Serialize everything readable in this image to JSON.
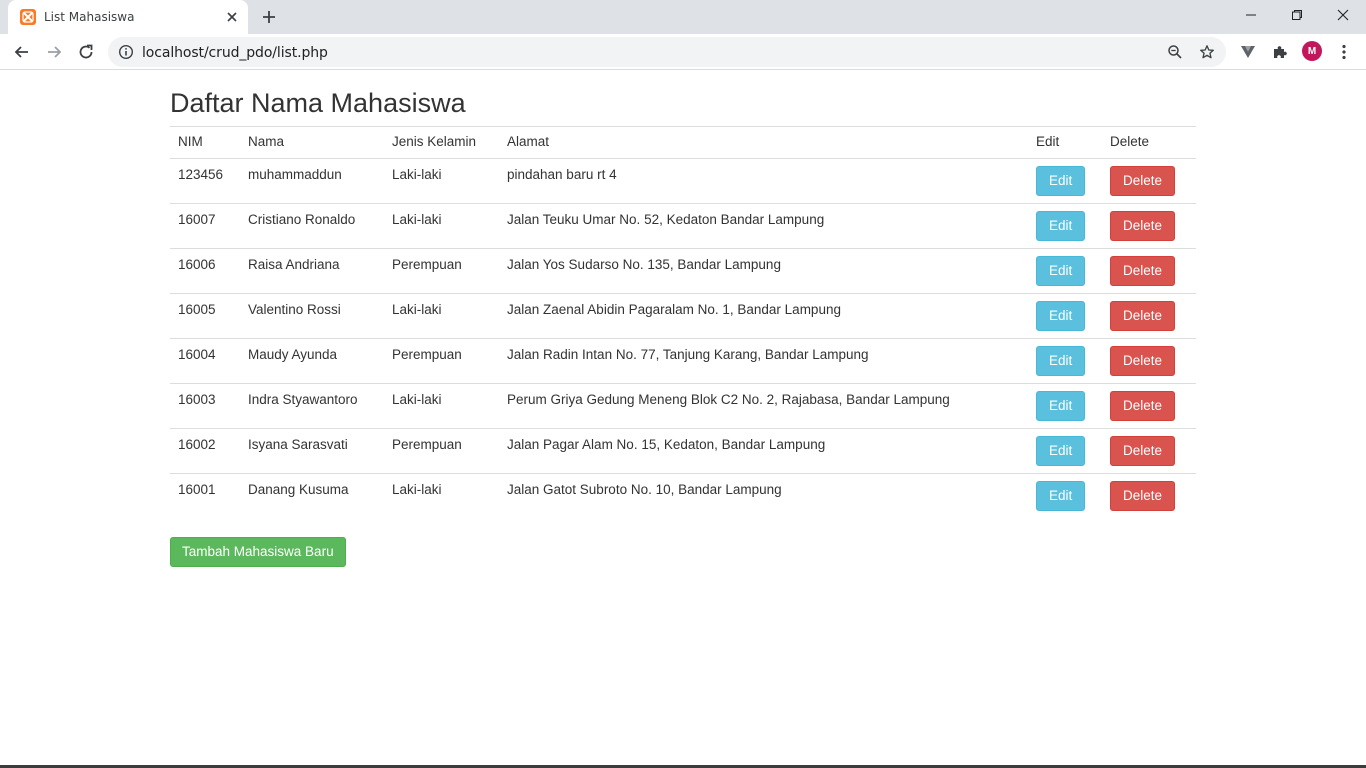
{
  "browser": {
    "tab_title": "List Mahasiswa",
    "url": "localhost/crud_pdo/list.php",
    "profile_initial": "M",
    "icons": [
      "xampp-icon",
      "close-icon",
      "plus-icon",
      "minimize-icon",
      "restore-icon",
      "back-icon",
      "forward-icon",
      "reload-icon",
      "info-icon",
      "zoom-icon",
      "star-icon",
      "vivaldi-extension-icon",
      "puzzle-icon",
      "kebab-menu-icon"
    ]
  },
  "page": {
    "title": "Daftar Nama Mahasiswa",
    "headers": {
      "nim": "NIM",
      "nama": "Nama",
      "jk": "Jenis Kelamin",
      "alamat": "Alamat",
      "edit": "Edit",
      "delete": "Delete"
    },
    "rows": [
      {
        "nim": "123456",
        "nama": "muhammaddun",
        "jk": "Laki-laki",
        "alamat": "pindahan baru rt 4",
        "edit": "Edit",
        "delete": "Delete"
      },
      {
        "nim": "16007",
        "nama": "Cristiano Ronaldo",
        "jk": "Laki-laki",
        "alamat": "Jalan Teuku Umar No. 52, Kedaton Bandar Lampung",
        "edit": "Edit",
        "delete": "Delete"
      },
      {
        "nim": "16006",
        "nama": "Raisa Andriana",
        "jk": "Perempuan",
        "alamat": "Jalan Yos Sudarso No. 135, Bandar Lampung",
        "edit": "Edit",
        "delete": "Delete"
      },
      {
        "nim": "16005",
        "nama": "Valentino Rossi",
        "jk": "Laki-laki",
        "alamat": "Jalan Zaenal Abidin Pagaralam No. 1, Bandar Lampung",
        "edit": "Edit",
        "delete": "Delete"
      },
      {
        "nim": "16004",
        "nama": "Maudy Ayunda",
        "jk": "Perempuan",
        "alamat": "Jalan Radin Intan No. 77, Tanjung Karang, Bandar Lampung",
        "edit": "Edit",
        "delete": "Delete"
      },
      {
        "nim": "16003",
        "nama": "Indra Styawantoro",
        "jk": "Laki-laki",
        "alamat": "Perum Griya Gedung Meneng Blok C2 No. 2, Rajabasa, Bandar Lampung",
        "edit": "Edit",
        "delete": "Delete"
      },
      {
        "nim": "16002",
        "nama": "Isyana Sarasvati",
        "jk": "Perempuan",
        "alamat": "Jalan Pagar Alam No. 15, Kedaton, Bandar Lampung",
        "edit": "Edit",
        "delete": "Delete"
      },
      {
        "nim": "16001",
        "nama": "Danang Kusuma",
        "jk": "Laki-laki",
        "alamat": "Jalan Gatot Subroto No. 10, Bandar Lampung",
        "edit": "Edit",
        "delete": "Delete"
      }
    ],
    "add_button": "Tambah Mahasiswa Baru"
  },
  "colors": {
    "edit_button": "#5bc0de",
    "delete_button": "#d9534f",
    "add_button": "#5cb85c"
  }
}
